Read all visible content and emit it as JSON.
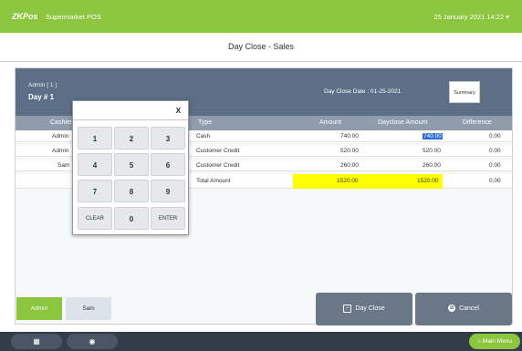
{
  "topbar": {
    "logo": "ZKPos",
    "app_title": "Supermarket POS",
    "datetime": "25 January 2021 14:22",
    "menu_arrow": "▾"
  },
  "page_title": "Day Close - Sales",
  "info": {
    "cashier": "Admin [ 1 ]",
    "day": "Day # 1",
    "close_date": "Day Close Date : 01-25-2021",
    "summary_label": "Summary"
  },
  "table": {
    "headers": [
      "Cashier",
      "Type",
      "Amount",
      "Dayclose Amount",
      "Difference"
    ],
    "rows": [
      {
        "cashier": "Admin",
        "type": "Cash",
        "amount": "740.00",
        "dayclose": "740.00",
        "difference": "0.00"
      },
      {
        "cashier": "Admin",
        "type": "Customer Credit",
        "amount": "520.00",
        "dayclose": "520.00",
        "difference": "0.00"
      },
      {
        "cashier": "Sam",
        "type": "Customer Credit",
        "amount": "260.00",
        "dayclose": "260.00",
        "difference": "0.00"
      }
    ],
    "total": {
      "type": "Total Amount",
      "amount": "1520.00",
      "dayclose": "1520.00",
      "difference": "0.00"
    }
  },
  "keypad": {
    "close": "X",
    "keys": [
      "1",
      "2",
      "3",
      "4",
      "5",
      "6",
      "7",
      "8",
      "9",
      "CLEAR",
      "0",
      "ENTER"
    ]
  },
  "users": {
    "admin": "Admin",
    "sam": "Sam"
  },
  "actions": {
    "day_close": "Day Close",
    "cancel": "Cancel"
  },
  "bottom": {
    "main_menu": "Main Menu",
    "calc_icon": "▦",
    "home_icon": "◉",
    "menu_home_icon": "⌂"
  },
  "colors": {
    "accent": "#8cc63f",
    "header": "#5d6f86",
    "highlight": "#ffff00",
    "selection": "#2f6ed6",
    "action": "#6a7787"
  }
}
